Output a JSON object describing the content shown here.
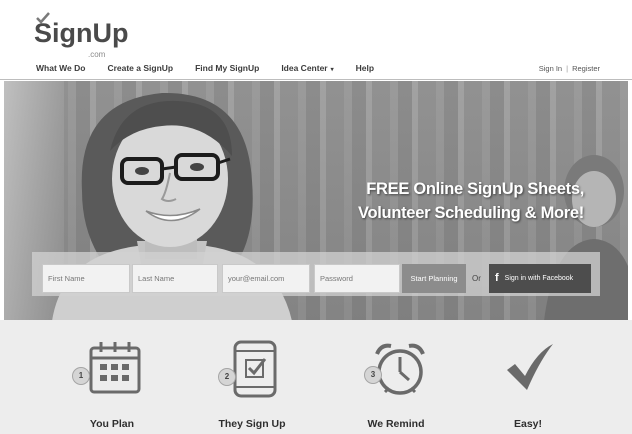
{
  "brand": {
    "name": "SignUp",
    "domain": ".com"
  },
  "nav": {
    "items": [
      "What We Do",
      "Create a SignUp",
      "Find My SignUp",
      "Idea Center",
      "Help"
    ],
    "idea_center_caret": "▾"
  },
  "auth": {
    "sign_in": "Sign In",
    "separator": "|",
    "register": "Register"
  },
  "hero": {
    "headline_line1": "FREE Online SignUp Sheets,",
    "headline_line2": "Volunteer Scheduling & More!"
  },
  "form": {
    "first_name_placeholder": "First Name",
    "last_name_placeholder": "Last Name",
    "email_placeholder": "your@email.com",
    "password_placeholder": "Password",
    "start_button": "Start Planning",
    "or_text": "Or",
    "facebook_button": "Sign in with Facebook",
    "facebook_glyph": "f"
  },
  "features": [
    {
      "number": "1",
      "label": "You Plan",
      "icon": "calendar-icon"
    },
    {
      "number": "2",
      "label": "They Sign Up",
      "icon": "phone-checkbox-icon"
    },
    {
      "number": "3",
      "label": "We Remind",
      "icon": "alarm-clock-icon"
    },
    {
      "number": "",
      "label": "Easy!",
      "icon": "checkmark-icon"
    }
  ],
  "colors": {
    "header_bg": "#ffffff",
    "features_bg": "#ededed",
    "button_dark": "#4d4d4d",
    "button_mid": "#8c8c8c"
  }
}
